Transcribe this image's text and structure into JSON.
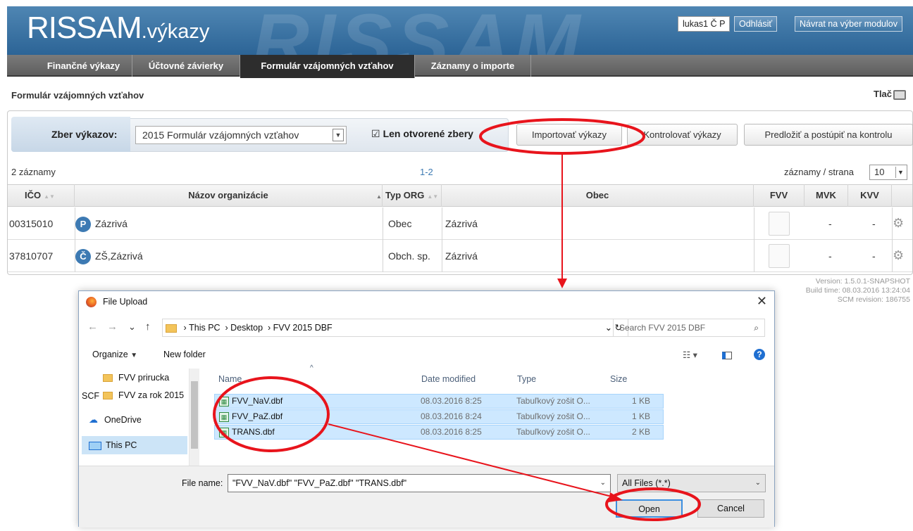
{
  "header": {
    "brand_main": "RISSAM",
    "brand_sub": ".výkazy",
    "bg_word": "RISSAM",
    "user": "lukas1 Č P",
    "logout": "Odhlásiť",
    "back": "Návrat na výber modulov"
  },
  "nav": {
    "tabs": [
      {
        "label": "Finančné výkazy"
      },
      {
        "label": "Účtovné závierky"
      },
      {
        "label": "Formulár vzájomných vzťahov"
      },
      {
        "label": "Záznamy o importe"
      }
    ],
    "active": "Formulár vzájomných vzťahov"
  },
  "page": {
    "title": "Formulár vzájomných vzťahov",
    "print": "Tlač"
  },
  "filter": {
    "label": "Zber výkazov:",
    "selected": "2015 Formulár vzájomných vzťahov",
    "checkbox_label": "Len otvorené zbery",
    "checkbox_checked": true
  },
  "actions": {
    "import": "Importovať výkazy",
    "check": "Kontrolovať výkazy",
    "submit": "Predložiť a postúpiť na kontrolu"
  },
  "grid": {
    "count": "2 záznamy",
    "range": "1-2",
    "per_page_label": "záznamy / strana",
    "per_page": "10",
    "columns": [
      "IČO",
      "Názov organizácie",
      "Typ ORG",
      "Obec",
      "FVV",
      "MVK",
      "KVV"
    ],
    "rows": [
      {
        "ico": "00315010",
        "badge": "P",
        "name": "Zázrivá",
        "type": "Obec",
        "obec": "Zázrivá",
        "mvk": "-",
        "kvv": "-"
      },
      {
        "ico": "37810707",
        "badge": "Č",
        "name": "ZŠ,Zázrivá",
        "type": "Obch. sp.",
        "obec": "Zázrivá",
        "mvk": "-",
        "kvv": "-"
      }
    ]
  },
  "version": {
    "line1": "Version: 1.5.0.1-SNAPSHOT",
    "line2": "Build time: 08.03.2016 13:24:04",
    "line3": "SCM revision: 186755"
  },
  "dialog": {
    "title": "File Upload",
    "breadcrumb": [
      "This PC",
      "Desktop",
      "FVV 2015 DBF"
    ],
    "search_placeholder": "Search FVV 2015 DBF",
    "organize": "Organize",
    "new_folder": "New folder",
    "nav_items": [
      "FVV prirucka SCF",
      "FVV za rok 2015",
      "OneDrive",
      "This PC"
    ],
    "columns": [
      "Name",
      "Date modified",
      "Type",
      "Size"
    ],
    "files": [
      {
        "name": "FVV_NaV.dbf",
        "date": "08.03.2016 8:25",
        "type": "Tabuľkový zošit O...",
        "size": "1 KB"
      },
      {
        "name": "FVV_PaZ.dbf",
        "date": "08.03.2016 8:24",
        "type": "Tabuľkový zošit O...",
        "size": "1 KB"
      },
      {
        "name": "TRANS.dbf",
        "date": "08.03.2016 8:25",
        "type": "Tabuľkový zošit O...",
        "size": "2 KB"
      }
    ],
    "file_name_label": "File name:",
    "file_name_value": "\"FVV_NaV.dbf\" \"FVV_PaZ.dbf\" \"TRANS.dbf\"",
    "file_type": "All Files (*.*)",
    "open": "Open",
    "cancel": "Cancel"
  },
  "colors": {
    "header_blue": "#2c6496",
    "nav_gray": "#5e5e5e",
    "annotation_red": "#e8141c",
    "selection_blue": "#cde8ff"
  }
}
